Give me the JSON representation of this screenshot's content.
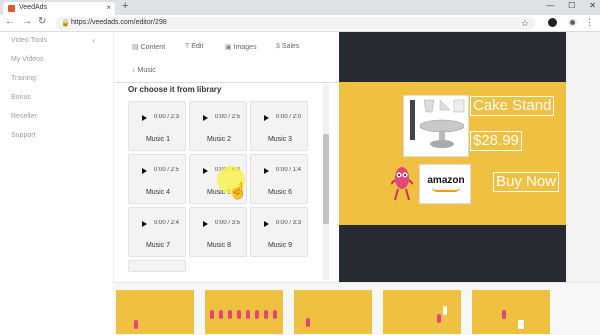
{
  "browser": {
    "tab_title": "VeedAds",
    "url": "https://veedads.com/editor/298",
    "new_tab": "+",
    "tab_close": "×",
    "window_controls": [
      "—",
      "☐",
      "✕"
    ]
  },
  "sidebar": {
    "collapse": "‹",
    "items": [
      {
        "label": "Video Tools"
      },
      {
        "label": "My Videos"
      },
      {
        "label": "Training"
      },
      {
        "label": "Bonus"
      },
      {
        "label": "Reseller"
      },
      {
        "label": "Support"
      }
    ]
  },
  "editor": {
    "tabs": [
      {
        "label": "Content",
        "icon": "content-icon"
      },
      {
        "label": "Edit",
        "icon": "text-icon"
      },
      {
        "label": "Images",
        "icon": "image-icon"
      },
      {
        "label": "Sales",
        "icon": "dollar-icon"
      },
      {
        "label": "Music",
        "icon": "music-icon"
      }
    ],
    "library_title": "Or choose it from library",
    "tracks": [
      {
        "name": "Music 1",
        "time": "0:00 / 2:3"
      },
      {
        "name": "Music 2",
        "time": "0:00 / 2:5"
      },
      {
        "name": "Music 3",
        "time": "0:00 / 2:0"
      },
      {
        "name": "Music 4",
        "time": "0:00 / 2:5"
      },
      {
        "name": "Music 5",
        "time": "0:00 / 4:0"
      },
      {
        "name": "Music 6",
        "time": "0:00 / 1:4"
      },
      {
        "name": "Music 7",
        "time": "0:00 / 2:4"
      },
      {
        "name": "Music 8",
        "time": "0:00 / 3:5"
      },
      {
        "name": "Music 9",
        "time": "0:00 / 3:3"
      }
    ]
  },
  "preview": {
    "product_name": "Cake Stand",
    "price": "$28.99",
    "cta": "Buy Now",
    "store_logo": "amazon",
    "colors": {
      "banner": "#f0c040",
      "background": "#262b34"
    }
  },
  "timeline": {
    "thumbnails": [
      "scene-1",
      "scene-2",
      "scene-3",
      "scene-4",
      "scene-5"
    ]
  }
}
